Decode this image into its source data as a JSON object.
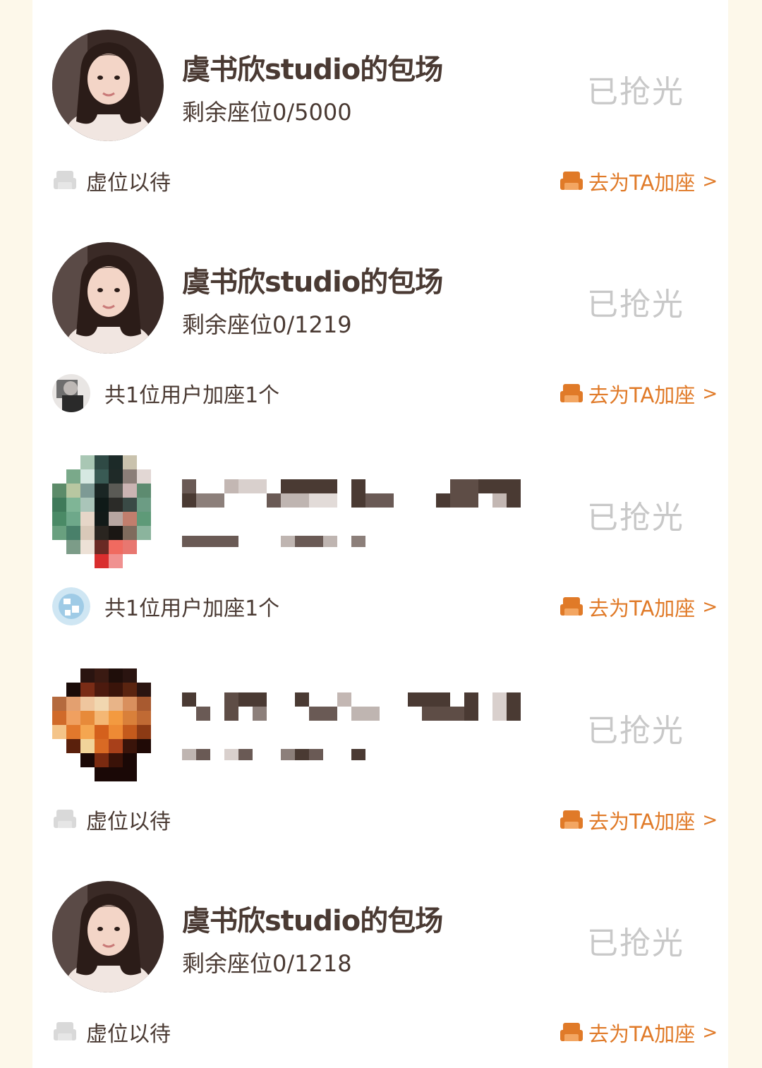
{
  "cards": [
    {
      "title": "虞书欣studio的包场",
      "seats": "剩余座位0/5000",
      "status": "已抢光",
      "footer_text": "虚位以待",
      "footer_type": "vacant",
      "action": "去为TA加座",
      "chevron": ">"
    },
    {
      "title": "虞书欣studio的包场",
      "seats": "剩余座位0/1219",
      "status": "已抢光",
      "footer_text": "共1位用户加座1个",
      "footer_type": "users",
      "action": "去为TA加座",
      "chevron": ">"
    },
    {
      "title": "",
      "seats": "",
      "status": "已抢光",
      "footer_text": "共1位用户加座1个",
      "footer_type": "users",
      "action": "去为TA加座",
      "chevron": ">"
    },
    {
      "title": "",
      "seats": "",
      "status": "已抢光",
      "footer_text": "虚位以待",
      "footer_type": "vacant",
      "action": "去为TA加座",
      "chevron": ">"
    },
    {
      "title": "虞书欣studio的包场",
      "seats": "剩余座位0/1218",
      "status": "已抢光",
      "footer_text": "虚位以待",
      "footer_type": "vacant",
      "action": "去为TA加座",
      "chevron": ">"
    }
  ],
  "colors": {
    "accent": "#e07a28",
    "muted": "#c8c8c8",
    "text": "#4a3a33",
    "background": "#fdf8ea"
  },
  "icons": {
    "vacant": "sofa-gray-icon",
    "action": "sofa-orange-icon"
  }
}
